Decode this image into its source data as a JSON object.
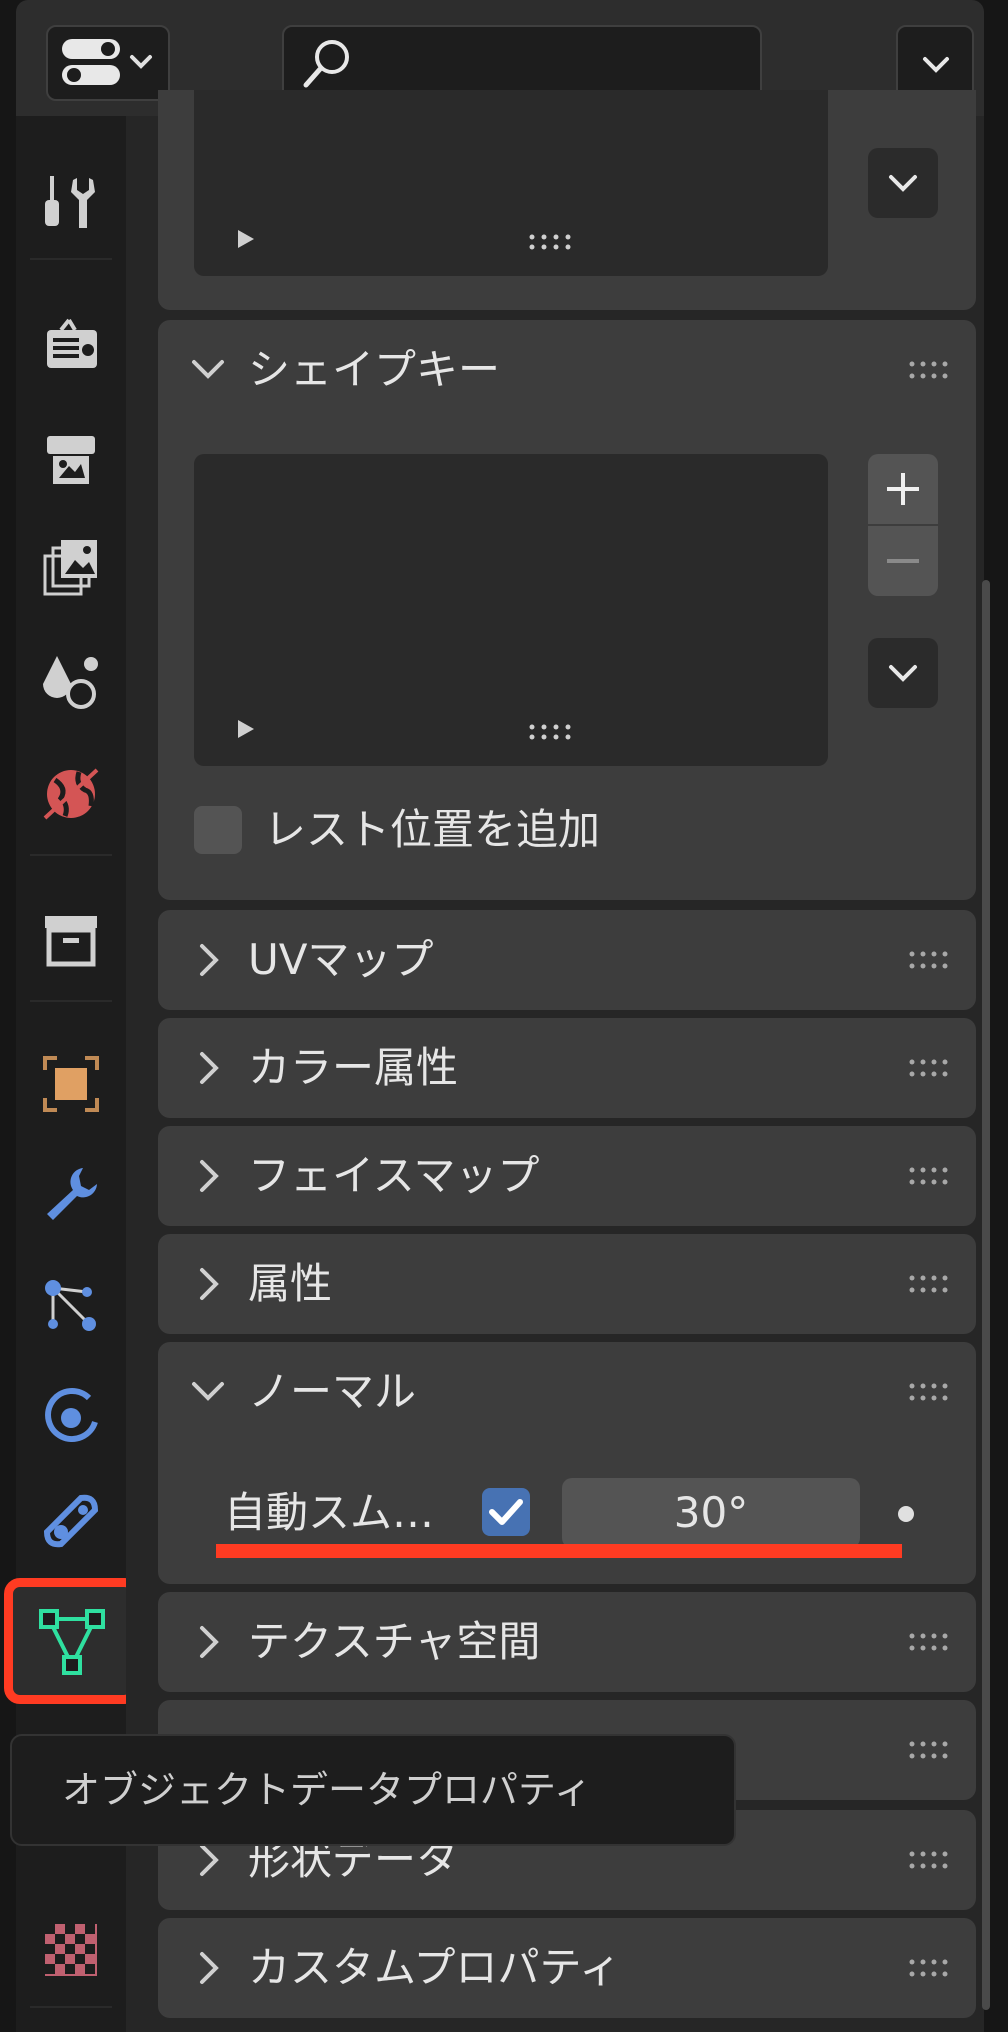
{
  "header": {
    "editor_type_icon": "toggle-icon",
    "search_placeholder": "",
    "search_icon": "search-icon",
    "menu_icon": "chevron-down-icon"
  },
  "tabs": [
    {
      "name": "tool",
      "icon": "tool-icon",
      "color": "#d0d0d0"
    },
    {
      "name": "render",
      "icon": "render-icon",
      "color": "#d0d0d0"
    },
    {
      "name": "output",
      "icon": "output-icon",
      "color": "#d0d0d0"
    },
    {
      "name": "view-layer",
      "icon": "view-layer-icon",
      "color": "#d0d0d0"
    },
    {
      "name": "scene",
      "icon": "scene-icon",
      "color": "#d0d0d0"
    },
    {
      "name": "world",
      "icon": "world-icon",
      "color": "#d45555"
    },
    {
      "name": "collection",
      "icon": "collection-icon",
      "color": "#d0d0d0"
    },
    {
      "name": "object",
      "icon": "object-icon",
      "color": "#e0a063"
    },
    {
      "name": "modifier",
      "icon": "wrench-icon",
      "color": "#5f8fe0"
    },
    {
      "name": "particles",
      "icon": "particles-icon",
      "color": "#5f8fe0"
    },
    {
      "name": "physics",
      "icon": "physics-icon",
      "color": "#5f8fe0"
    },
    {
      "name": "constraints",
      "icon": "constraint-icon",
      "color": "#5f8fe0"
    },
    {
      "name": "object-data",
      "icon": "mesh-data-icon",
      "color": "#2fe0a0",
      "active": true
    },
    {
      "name": "texture",
      "icon": "checker-icon",
      "color": "#c06070"
    }
  ],
  "panels": {
    "shape_keys": {
      "title": "シェイプキー",
      "add_rest_position": "レスト位置を追加",
      "add_rest_position_checked": false
    },
    "uv_maps": {
      "title": "UVマップ"
    },
    "color_attributes": {
      "title": "カラー属性"
    },
    "face_maps": {
      "title": "フェイスマップ"
    },
    "attributes": {
      "title": "属性"
    },
    "normals": {
      "title": "ノーマル",
      "auto_smooth_label": "自動スム…",
      "auto_smooth_checked": true,
      "angle_value": "30°"
    },
    "texture_space": {
      "title": "テクスチャ空間"
    },
    "geometry_data": {
      "title": "形状データ"
    },
    "custom_properties": {
      "title": "カスタムプロパティ"
    }
  },
  "tooltip": {
    "text": "オブジェクトデータプロパティ"
  },
  "colors": {
    "highlight": "#ff3b22",
    "accent": "#4772b3"
  }
}
